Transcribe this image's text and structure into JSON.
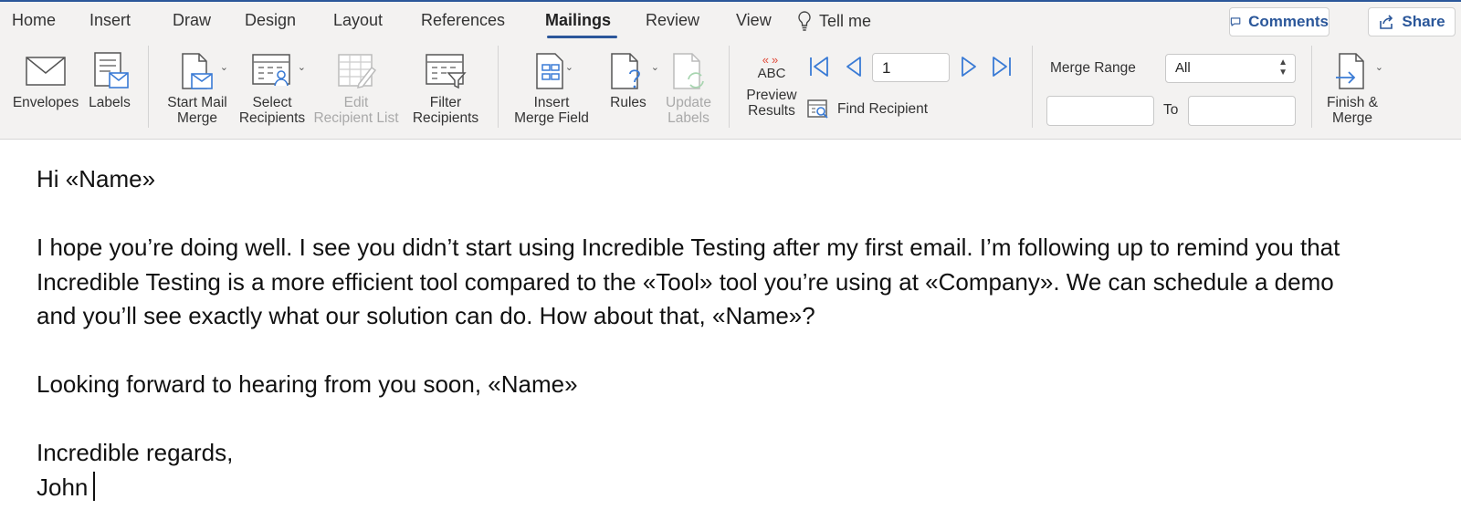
{
  "tabs": [
    "Home",
    "Insert",
    "Draw",
    "Design",
    "Layout",
    "References",
    "Mailings",
    "Review",
    "View"
  ],
  "active_tab": "Mailings",
  "tell_me": "Tell me",
  "comments_label": "Comments",
  "share_label": "Share",
  "ribbon": {
    "envelopes": "Envelopes",
    "labels": "Labels",
    "start_mail_merge": [
      "Start Mail",
      "Merge"
    ],
    "select_recipients": [
      "Select",
      "Recipients"
    ],
    "edit_recipient_list": [
      "Edit",
      "Recipient List"
    ],
    "filter_recipients": [
      "Filter",
      "Recipients"
    ],
    "insert_merge_field": [
      "Insert",
      "Merge Field"
    ],
    "rules": "Rules",
    "update_labels": [
      "Update",
      "Labels"
    ],
    "preview_abc": "ABC",
    "preview_results": [
      "Preview",
      "Results"
    ],
    "record_number": "1",
    "find_recipient": "Find Recipient",
    "merge_range_label": "Merge Range",
    "merge_range_value": "All",
    "from_value": "",
    "to_label": "To",
    "to_value": "",
    "finish_merge": [
      "Finish &",
      "Merge"
    ]
  },
  "document": {
    "greeting": "Hi «Name»",
    "body_line1": "I hope you’re doing well. I see you didn’t start using Incredible Testing after my first email. I’m following up to remind you that",
    "body_line2": "Incredible Testing is a more efficient tool compared to the «Tool» tool you’re using at «Company». We can schedule a demo",
    "body_line3": "and you’ll see exactly what our solution can do. How about that, «Name»?",
    "closing": "Looking forward to hearing from you soon, «Name»",
    "signoff": "Incredible regards,",
    "signature": "John"
  },
  "colors": {
    "accent": "#2b579a",
    "icon_blue": "#3a7bd5",
    "ribbon_bg": "#f3f2f1",
    "disabled": "#a9a9a9",
    "preview_red": "#e04a3a"
  }
}
